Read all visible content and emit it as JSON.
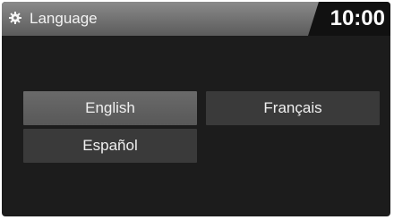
{
  "header": {
    "title": "Language",
    "clock": "10:00",
    "icon": "gear-icon"
  },
  "languages": [
    {
      "label": "English",
      "selected": true
    },
    {
      "label": "Français",
      "selected": false
    },
    {
      "label": "Español",
      "selected": false
    }
  ],
  "colors": {
    "screen_background": "#1c1c1c",
    "header_background": "#6f6f6f",
    "button_background": "#3a3a3a",
    "button_selected_background": "#626262",
    "text": "#f0f0f0"
  }
}
